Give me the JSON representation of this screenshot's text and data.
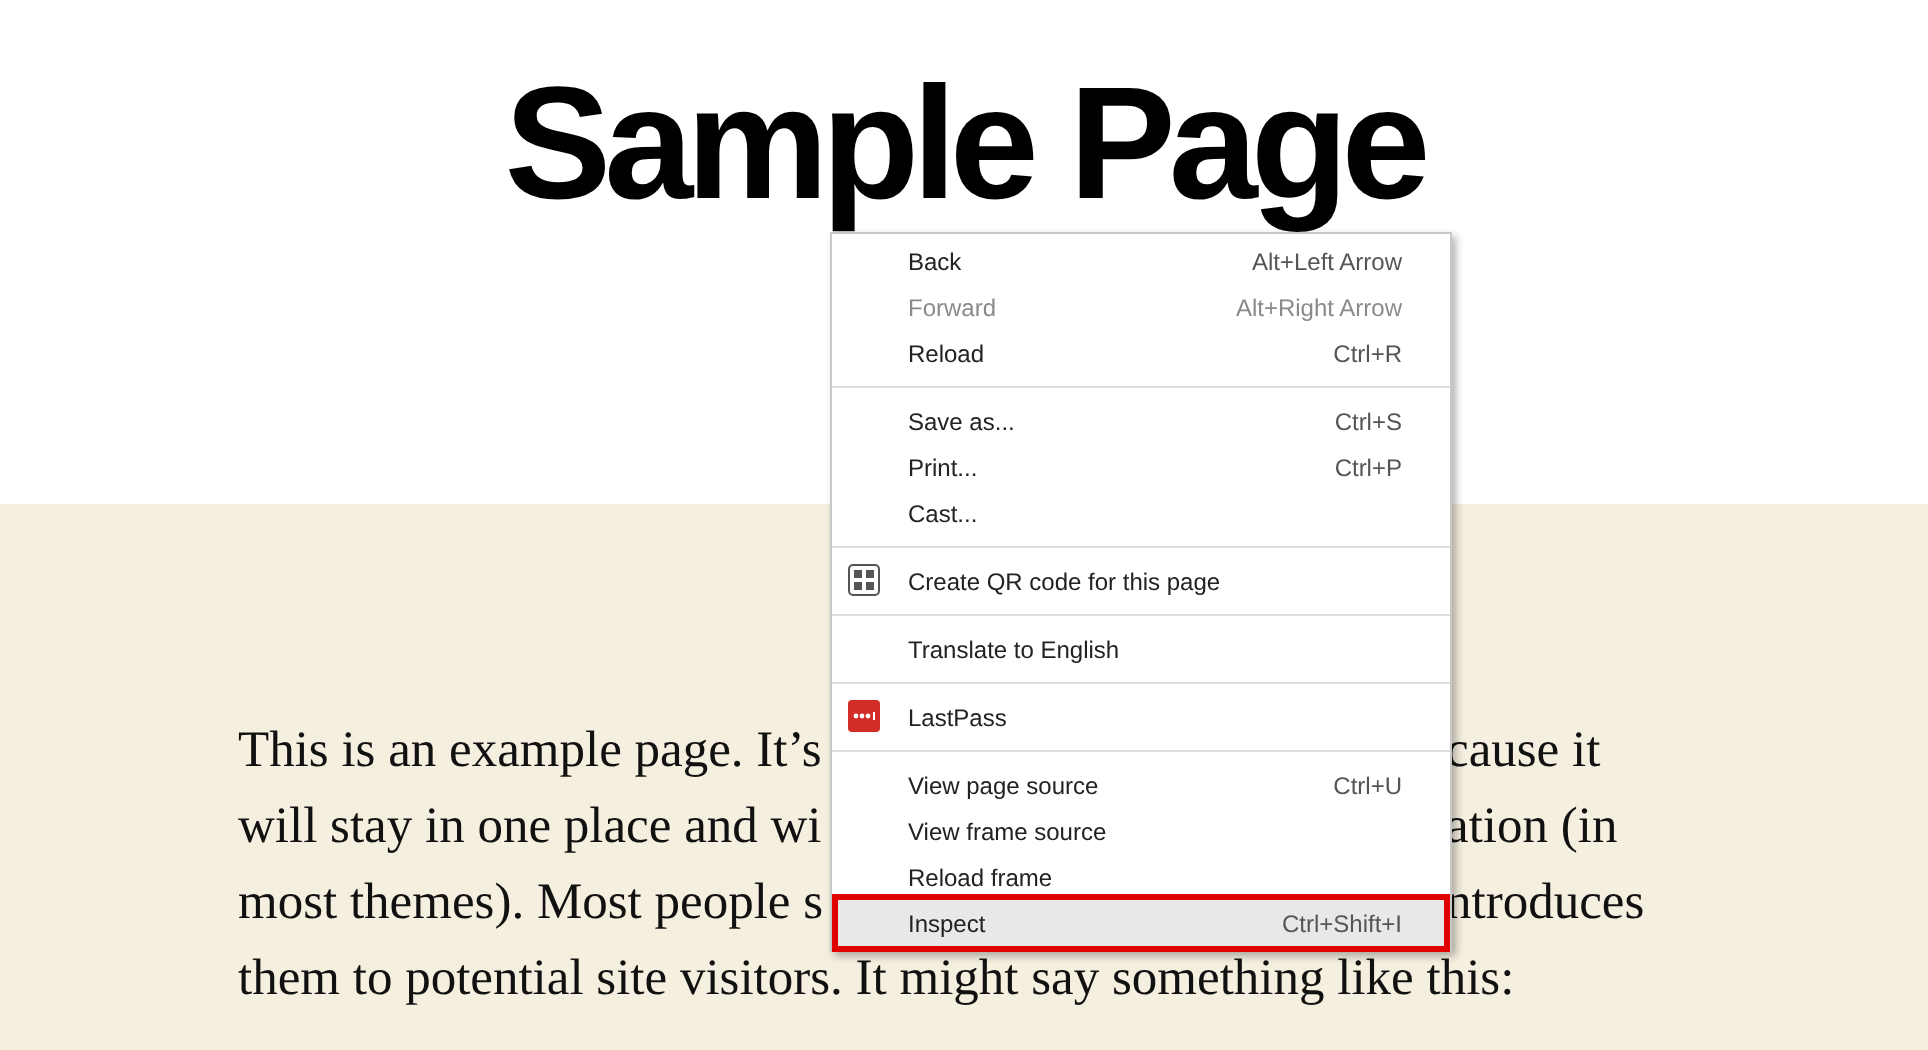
{
  "page": {
    "title": "Sample Page",
    "paragraph_lines": [
      {
        "left": "This is an example page. It’s",
        "right": "cause it"
      },
      {
        "left": "will stay in one place and wi",
        "right": "ation (in"
      },
      {
        "left": "most themes). Most people s",
        "right": "ntroduces"
      },
      {
        "left": "them to potential site visitors. It might say something like this:"
      }
    ]
  },
  "context_menu": {
    "groups": [
      {
        "items": [
          {
            "label": "Back",
            "kind": "text",
            "shortcut": "Alt+Left Arrow",
            "disabled": false,
            "highlighted": false
          },
          {
            "label": "Forward",
            "kind": "text",
            "shortcut": "Alt+Right Arrow",
            "disabled": true,
            "highlighted": false
          },
          {
            "label": "Reload",
            "kind": "text",
            "shortcut": "Ctrl+R",
            "disabled": false,
            "highlighted": false
          }
        ]
      },
      {
        "items": [
          {
            "label": "Save as...",
            "kind": "text",
            "shortcut": "Ctrl+S",
            "disabled": false,
            "highlighted": false
          },
          {
            "label": "Print...",
            "kind": "text",
            "shortcut": "Ctrl+P",
            "disabled": false,
            "highlighted": false
          },
          {
            "label": "Cast...",
            "kind": "text",
            "disabled": false,
            "highlighted": false
          }
        ]
      },
      {
        "items": [
          {
            "label": "Create QR code for this page",
            "kind": "grid",
            "disabled": false,
            "highlighted": false
          }
        ]
      },
      {
        "items": [
          {
            "label": "Translate to English",
            "kind": "text",
            "disabled": false,
            "highlighted": false
          }
        ]
      },
      {
        "items": [
          {
            "label": "LastPass",
            "kind": "brand",
            "disabled": false,
            "highlighted": false
          }
        ]
      },
      {
        "items": [
          {
            "label": "View page source",
            "kind": "text",
            "shortcut": "Ctrl+U",
            "disabled": false,
            "highlighted": false
          },
          {
            "label": "View frame source",
            "kind": "text",
            "disabled": false,
            "highlighted": false
          },
          {
            "label": "Reload frame",
            "kind": "text",
            "disabled": false,
            "highlighted": false
          },
          {
            "label": "Inspect",
            "kind": "text",
            "shortcut": "Ctrl+Shift+I",
            "disabled": false,
            "highlighted": true
          }
        ]
      }
    ]
  }
}
